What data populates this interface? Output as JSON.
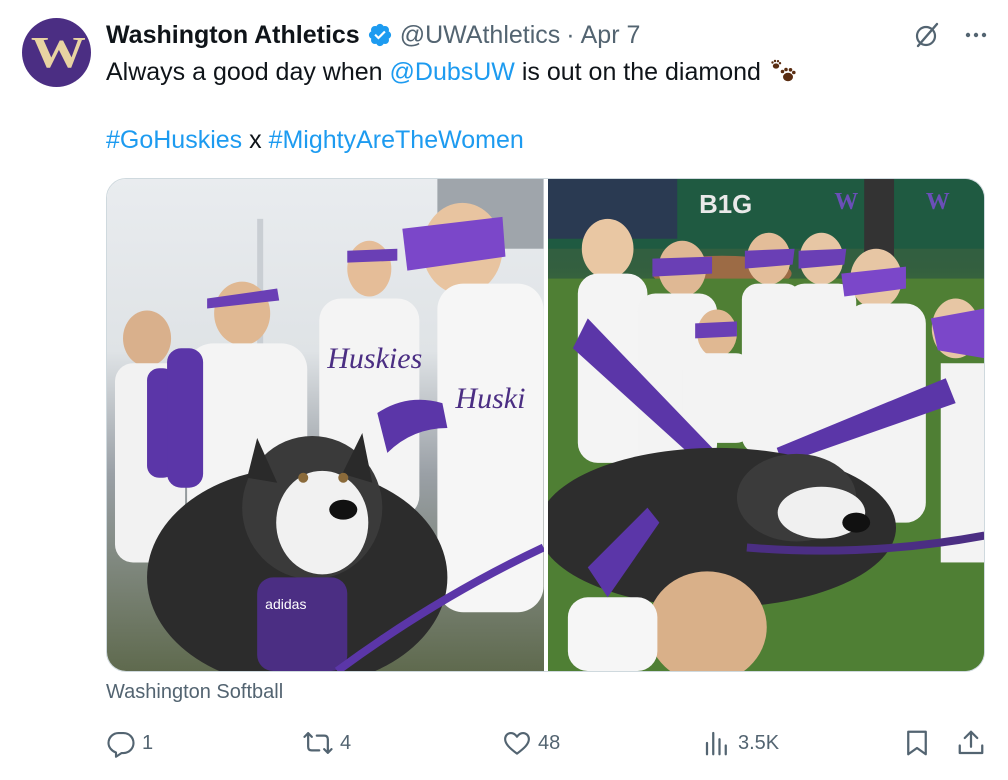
{
  "tweet": {
    "display_name": "Washington Athletics",
    "handle": "@UWAthletics",
    "separator": "·",
    "date": "Apr 7",
    "avatar_letter": "W",
    "text_before": "Always a good day when ",
    "mention": "@DubsUW",
    "text_after": " is out on the diamond",
    "hashtag1": "#GoHuskies",
    "hashtag_join": " x ",
    "hashtag2": "#MightyAreTheWomen",
    "media_source": "Washington Softball",
    "media": [
      {
        "name": "photo-left",
        "description": "softball players petting husky mascot"
      },
      {
        "name": "photo-right",
        "description": "players huddled around husky on field"
      }
    ]
  },
  "actions": {
    "replies": "1",
    "reposts": "4",
    "likes": "48",
    "views": "3.5K"
  },
  "colors": {
    "accent": "#1d9bf0",
    "uw_purple": "#4b2e83",
    "uw_gold": "#e8d3a2",
    "muted": "#536471"
  },
  "icons": [
    "verified-badge-icon",
    "grok-icon",
    "more-icon",
    "paw-prints-icon",
    "reply-icon",
    "repost-icon",
    "like-icon",
    "views-icon",
    "bookmark-icon",
    "share-icon"
  ]
}
